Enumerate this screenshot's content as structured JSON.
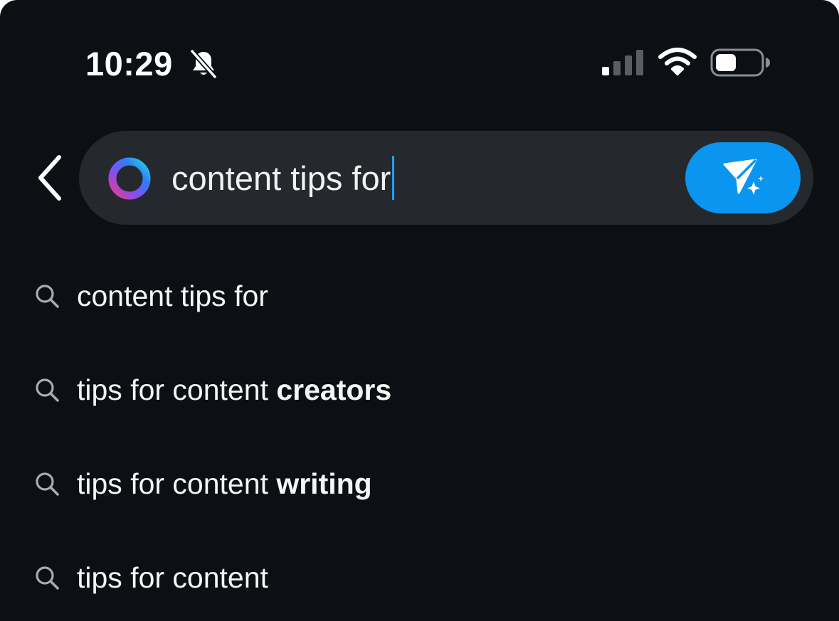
{
  "status_bar": {
    "time": "10:29",
    "bell_icon": "bell-slash-icon",
    "signal_icon": "cellular-signal-icon",
    "wifi_icon": "wifi-icon",
    "battery_icon": "battery-icon"
  },
  "search": {
    "query": "content tips for",
    "assistant_icon": "meta-ai-ring-icon",
    "send_icon": "send-sparkle-icon",
    "accent_color": "#0a95f0"
  },
  "suggestions": [
    {
      "prefix": "content tips for",
      "emphasis": ""
    },
    {
      "prefix": "tips for content ",
      "emphasis": "creators"
    },
    {
      "prefix": "tips for content ",
      "emphasis": "writing"
    },
    {
      "prefix": "tips for content",
      "emphasis": ""
    }
  ]
}
